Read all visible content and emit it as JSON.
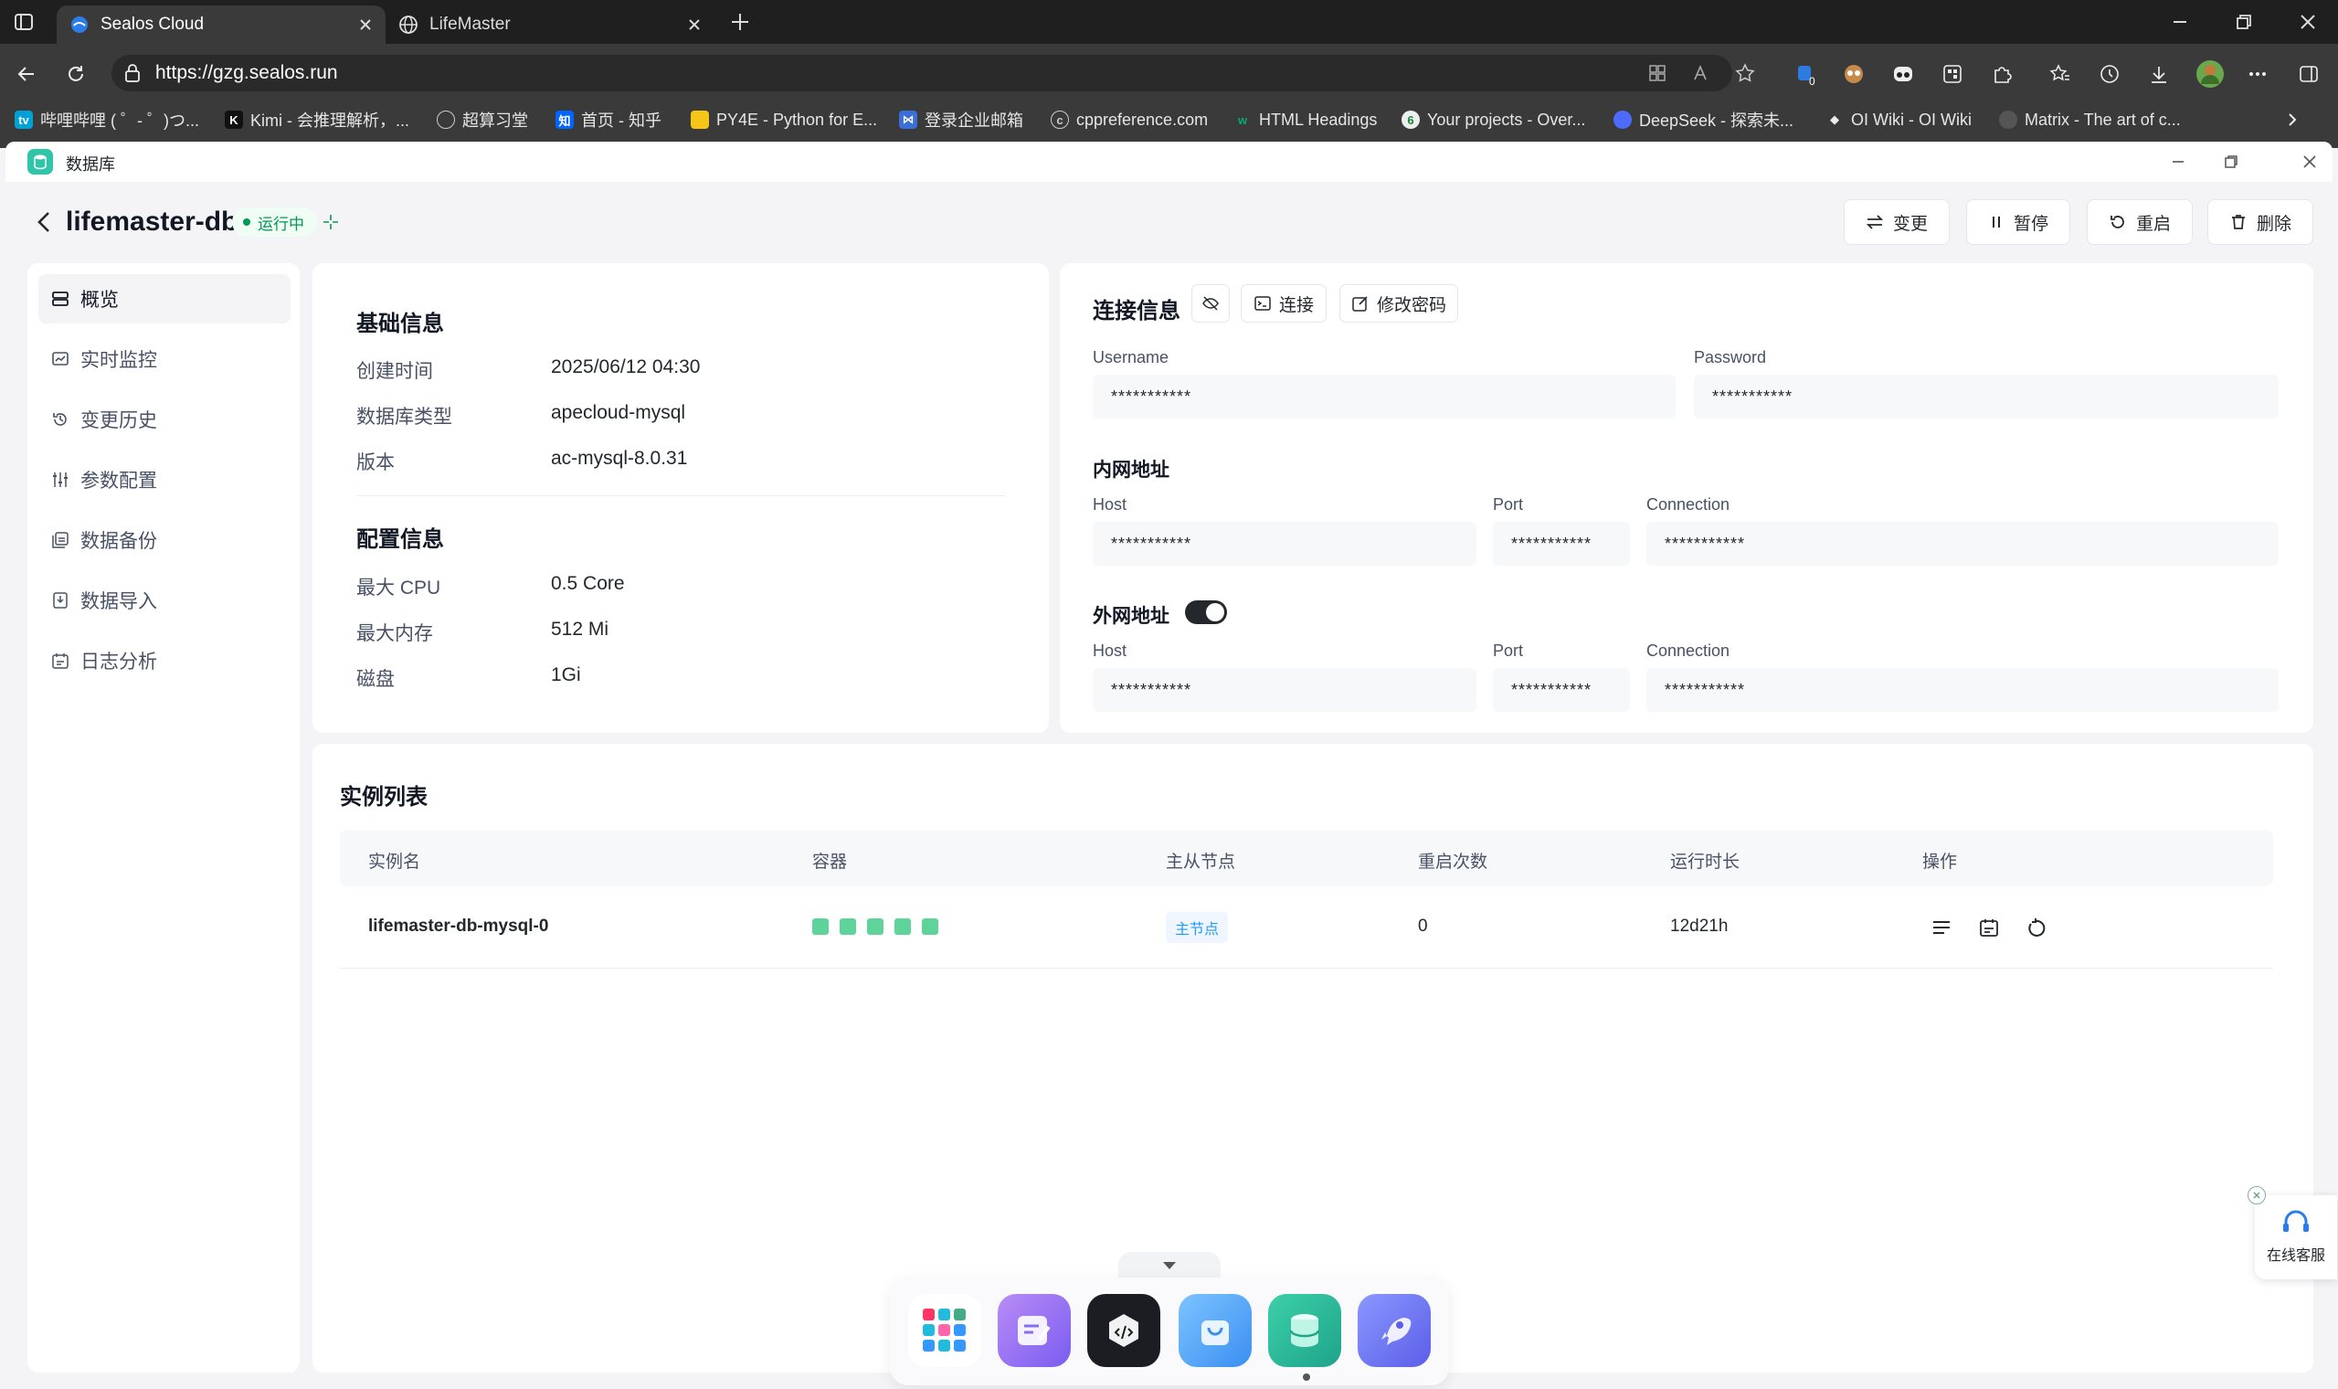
{
  "browser": {
    "tabs": [
      {
        "title": "Sealos Cloud",
        "active": true
      },
      {
        "title": "LifeMaster",
        "active": false
      }
    ],
    "url": "https://gzg.sealos.run",
    "bookmarks": [
      "哔哩哔哩 ( ゜- ゜)つ...",
      "Kimi - 会推理解析，...",
      "超算习堂",
      "首页 - 知乎",
      "PY4E - Python for E...",
      "登录企业邮箱",
      "cppreference.com",
      "HTML Headings",
      "Your projects - Over...",
      "DeepSeek - 探索未...",
      "OI Wiki - OI Wiki",
      "Matrix - The art of c..."
    ],
    "extension_badge": "0"
  },
  "app": {
    "title": "数据库",
    "db_name": "lifemaster-db",
    "status": "运行中",
    "actions": {
      "change": "变更",
      "pause": "暂停",
      "restart": "重启",
      "delete": "删除"
    }
  },
  "sidebar": {
    "items": [
      {
        "label": "概览",
        "icon": "overview-icon",
        "active": true
      },
      {
        "label": "实时监控",
        "icon": "monitor-icon"
      },
      {
        "label": "变更历史",
        "icon": "history-icon"
      },
      {
        "label": "参数配置",
        "icon": "params-icon"
      },
      {
        "label": "数据备份",
        "icon": "backup-icon"
      },
      {
        "label": "数据导入",
        "icon": "import-icon"
      },
      {
        "label": "日志分析",
        "icon": "log-icon"
      }
    ]
  },
  "basic_info": {
    "title": "基础信息",
    "rows": [
      {
        "label": "创建时间",
        "value": "2025/06/12 04:30"
      },
      {
        "label": "数据库类型",
        "value": "apecloud-mysql"
      },
      {
        "label": "版本",
        "value": "ac-mysql-8.0.31"
      }
    ]
  },
  "config_info": {
    "title": "配置信息",
    "rows": [
      {
        "label": "最大 CPU",
        "value": "0.5 Core"
      },
      {
        "label": "最大内存",
        "value": "512 Mi"
      },
      {
        "label": "磁盘",
        "value": "1Gi"
      }
    ]
  },
  "connection": {
    "title": "连接信息",
    "connect_label": "连接",
    "change_password_label": "修改密码",
    "username_label": "Username",
    "password_label": "Password",
    "masked": "***********",
    "internal": {
      "title": "内网地址",
      "host_label": "Host",
      "port_label": "Port",
      "connection_label": "Connection"
    },
    "external": {
      "title": "外网地址",
      "enabled": true,
      "host_label": "Host",
      "port_label": "Port",
      "connection_label": "Connection"
    }
  },
  "instances": {
    "title": "实例列表",
    "columns": [
      "实例名",
      "容器",
      "主从节点",
      "重启次数",
      "运行时长",
      "操作"
    ],
    "rows": [
      {
        "name": "lifemaster-db-mysql-0",
        "containers": 5,
        "role": "主节点",
        "restarts": "0",
        "uptime": "12d21h"
      }
    ]
  },
  "support": {
    "label": "在线客服"
  },
  "colors": {
    "accent": "#219bf4",
    "success": "#039855",
    "container": "#5fd49a",
    "dark": "#24282c"
  }
}
